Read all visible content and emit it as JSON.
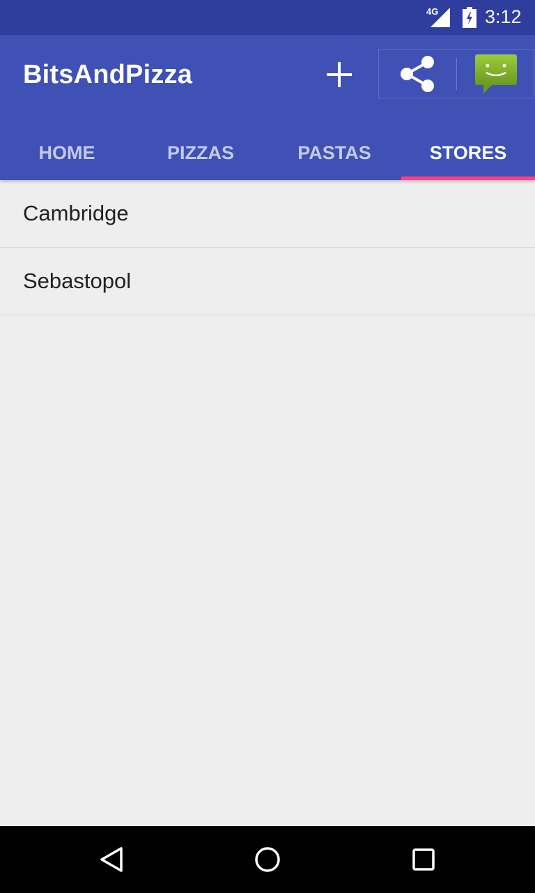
{
  "status_bar": {
    "network": "4G",
    "time": "3:12"
  },
  "app_bar": {
    "title": "BitsAndPizza",
    "actions": {
      "add_icon": "plus-icon",
      "share_icon": "share-icon",
      "share_target_icon": "messaging-app-icon"
    }
  },
  "tabs": [
    {
      "label": "HOME",
      "active": false
    },
    {
      "label": "PIZZAS",
      "active": false
    },
    {
      "label": "PASTAS",
      "active": false
    },
    {
      "label": "STORES",
      "active": true
    }
  ],
  "stores": [
    {
      "name": "Cambridge"
    },
    {
      "name": "Sebastopol"
    }
  ],
  "nav_bar": {
    "back_icon": "back-triangle-icon",
    "home_icon": "home-circle-icon",
    "recents_icon": "recents-square-icon"
  },
  "colors": {
    "primary": "#3f51b5",
    "primary_dark": "#2f3e9e",
    "accent": "#ff4081",
    "background": "#eeeeee"
  }
}
